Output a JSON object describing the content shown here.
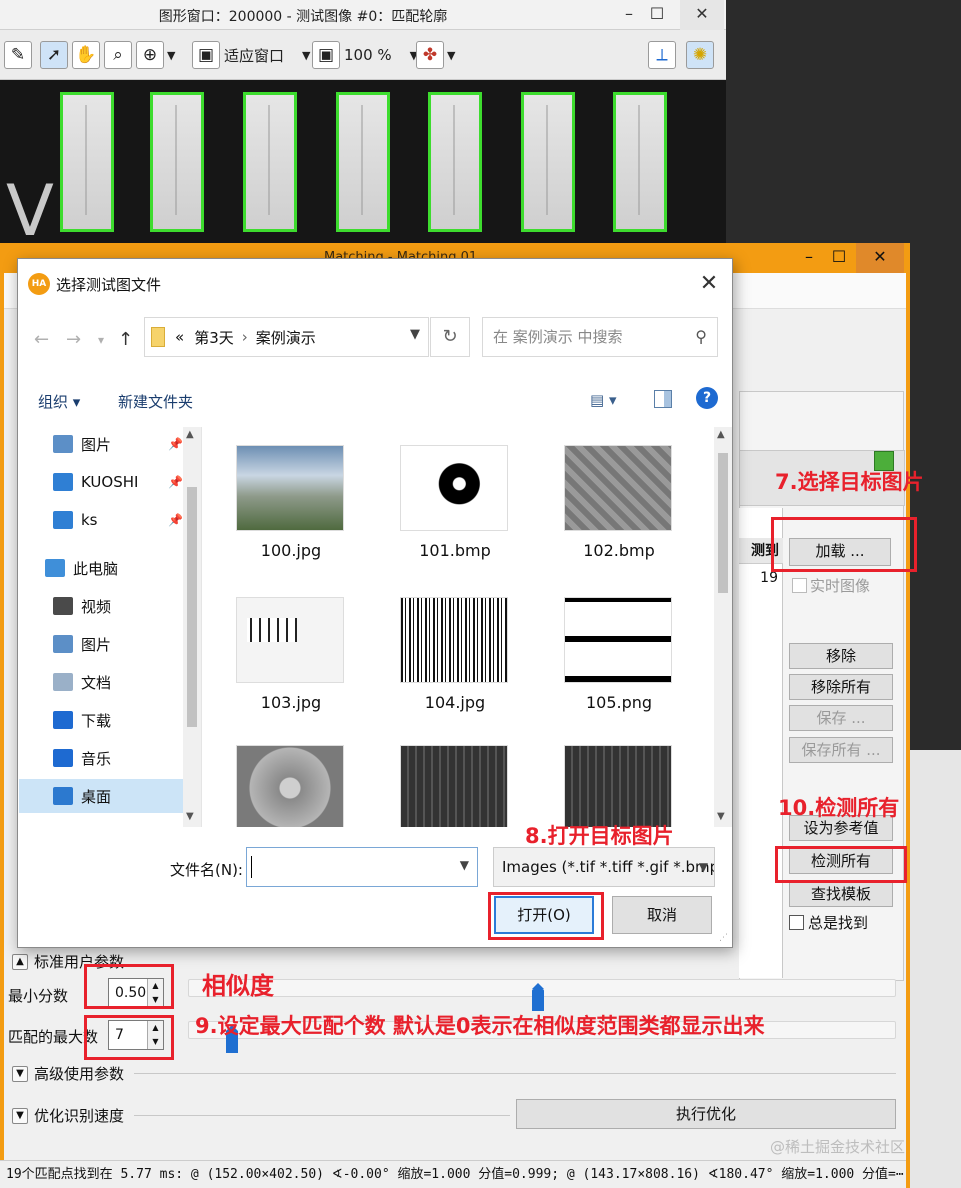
{
  "graphics_window": {
    "title": "图形窗口：200000 - 测试图像 #0：匹配轮廓",
    "toolbar": {
      "fit_label": "适应窗口",
      "zoom_label": "100 %"
    }
  },
  "matching_window": {
    "title": "Matching - Matching 01",
    "load_button": "加载 ...",
    "live_image_label": "实时图像",
    "list_header": "测到",
    "list_value": "19",
    "remove_button": "移除",
    "remove_all_button": "移除所有",
    "save_button": "保存 ...",
    "save_all_button": "保存所有 ...",
    "set_reference_button": "设为参考值",
    "detect_all_button": "检测所有",
    "find_model_button": "查找模板",
    "always_find_label": "总是找到",
    "standard_params_label": "标准用户参数",
    "min_score_label": "最小分数",
    "min_score_value": "0.50",
    "max_matches_label": "匹配的最大数",
    "max_matches_value": "7",
    "advanced_params_label": "高级使用参数",
    "optimize_label": "优化识别速度",
    "run_optimize_button": "执行优化"
  },
  "status_bar": "19个匹配点找到在 5.77 ms: @ (152.00×402.50) ∢-0.00° 缩放=1.000 分值=0.999; @ (143.17×808.16) ∢180.47° 缩放=1.000 分值=⋯",
  "watermark": "@稀土掘金技术社区",
  "file_dialog": {
    "title": "选择测试图文件",
    "breadcrumb": {
      "prefix": "«",
      "parent": "第3天",
      "current": "案例演示"
    },
    "search_placeholder": "在 案例演示 中搜索",
    "organize_label": "组织 ▾",
    "new_folder_label": "新建文件夹",
    "nav_items": [
      {
        "label": "图片",
        "icon": "pictures-icon",
        "pinned": true
      },
      {
        "label": "KUOSHI",
        "icon": "monitor-icon",
        "pinned": true
      },
      {
        "label": "ks",
        "icon": "monitor-icon",
        "pinned": true
      },
      {
        "label": "此电脑",
        "icon": "computer-icon",
        "pinned": false
      },
      {
        "label": "视频",
        "icon": "video-icon",
        "pinned": false
      },
      {
        "label": "图片",
        "icon": "pictures-icon",
        "pinned": false
      },
      {
        "label": "文档",
        "icon": "document-icon",
        "pinned": false
      },
      {
        "label": "下载",
        "icon": "download-icon",
        "pinned": false
      },
      {
        "label": "音乐",
        "icon": "music-icon",
        "pinned": false
      },
      {
        "label": "桌面",
        "icon": "desktop-icon",
        "pinned": false
      }
    ],
    "files": [
      {
        "name": "100.jpg",
        "thumb": "landscape"
      },
      {
        "name": "101.bmp",
        "thumb": "ring"
      },
      {
        "name": "102.bmp",
        "thumb": "board"
      },
      {
        "name": "103.jpg",
        "thumb": "label"
      },
      {
        "name": "104.jpg",
        "thumb": "barcode"
      },
      {
        "name": "105.png",
        "thumb": "qr"
      },
      {
        "name": "",
        "thumb": "disc"
      },
      {
        "name": "",
        "thumb": "chip"
      },
      {
        "name": "",
        "thumb": "chip"
      }
    ],
    "filename_label": "文件名(N):",
    "filename_value": "",
    "filetype_value": "Images (*.tif *.tiff *.gif *.bmp",
    "open_button": "打开(O)",
    "cancel_button": "取消"
  },
  "annotations": {
    "select_image": "7.选择目标图片",
    "open_image": "8.打开目标图片",
    "max_matches_note": "9.设定最大匹配个数 默认是0表示在相似度范围类都显示出来",
    "detect_all": "10.检测所有",
    "similarity": "相似度"
  },
  "colors": {
    "accent_orange": "#f39c12",
    "annotation_red": "#e8212c",
    "contour_green": "#3ddc2e",
    "slider_blue": "#1f6fd1"
  }
}
